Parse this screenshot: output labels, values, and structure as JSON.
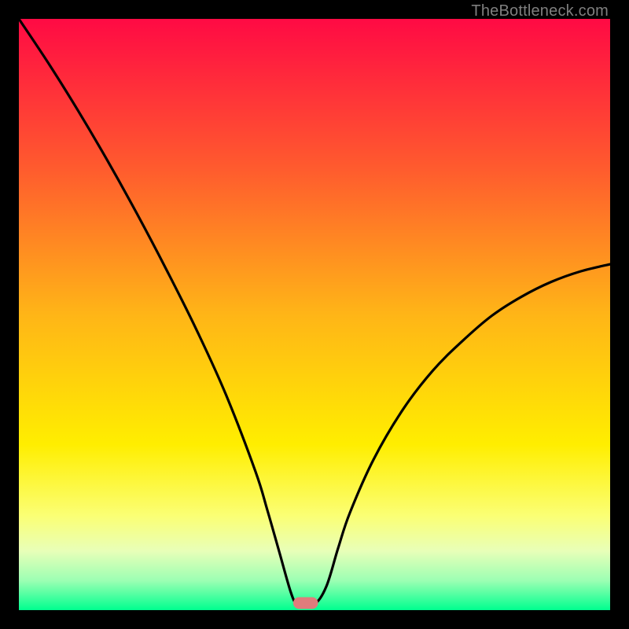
{
  "watermark": "TheBottleneck.com",
  "chart_data": {
    "type": "line",
    "title": "",
    "xlabel": "",
    "ylabel": "",
    "xlim": [
      0,
      100
    ],
    "ylim": [
      0,
      100
    ],
    "grid": false,
    "legend": false,
    "background": {
      "type": "vertical_gradient",
      "stops": [
        {
          "offset": 0.0,
          "color": "#ff0a44"
        },
        {
          "offset": 0.25,
          "color": "#ff5a2e"
        },
        {
          "offset": 0.5,
          "color": "#ffb517"
        },
        {
          "offset": 0.72,
          "color": "#ffee00"
        },
        {
          "offset": 0.84,
          "color": "#fbff74"
        },
        {
          "offset": 0.9,
          "color": "#e8ffb8"
        },
        {
          "offset": 0.95,
          "color": "#9cffb3"
        },
        {
          "offset": 1.0,
          "color": "#00ff8f"
        }
      ]
    },
    "series": [
      {
        "name": "bottleneck-curve",
        "color": "#000000",
        "x": [
          0,
          5,
          10,
          15,
          20,
          25,
          30,
          35,
          40,
          42,
          44,
          46,
          47,
          48,
          50,
          52,
          54,
          56,
          60,
          65,
          70,
          75,
          80,
          85,
          90,
          95,
          100
        ],
        "values": [
          100,
          92.5,
          84.5,
          76.0,
          67.0,
          57.5,
          47.5,
          36.5,
          23.5,
          17.0,
          10.0,
          3.0,
          1.0,
          1.0,
          1.0,
          4.0,
          10.5,
          16.5,
          25.5,
          34.0,
          40.5,
          45.5,
          49.8,
          53.0,
          55.5,
          57.3,
          58.5
        ]
      }
    ],
    "marker": {
      "name": "marker",
      "shape": "rounded_rect",
      "color": "#e07c7c",
      "x": 48.5,
      "y": 1.2,
      "width": 4.2,
      "height": 2.0
    }
  }
}
